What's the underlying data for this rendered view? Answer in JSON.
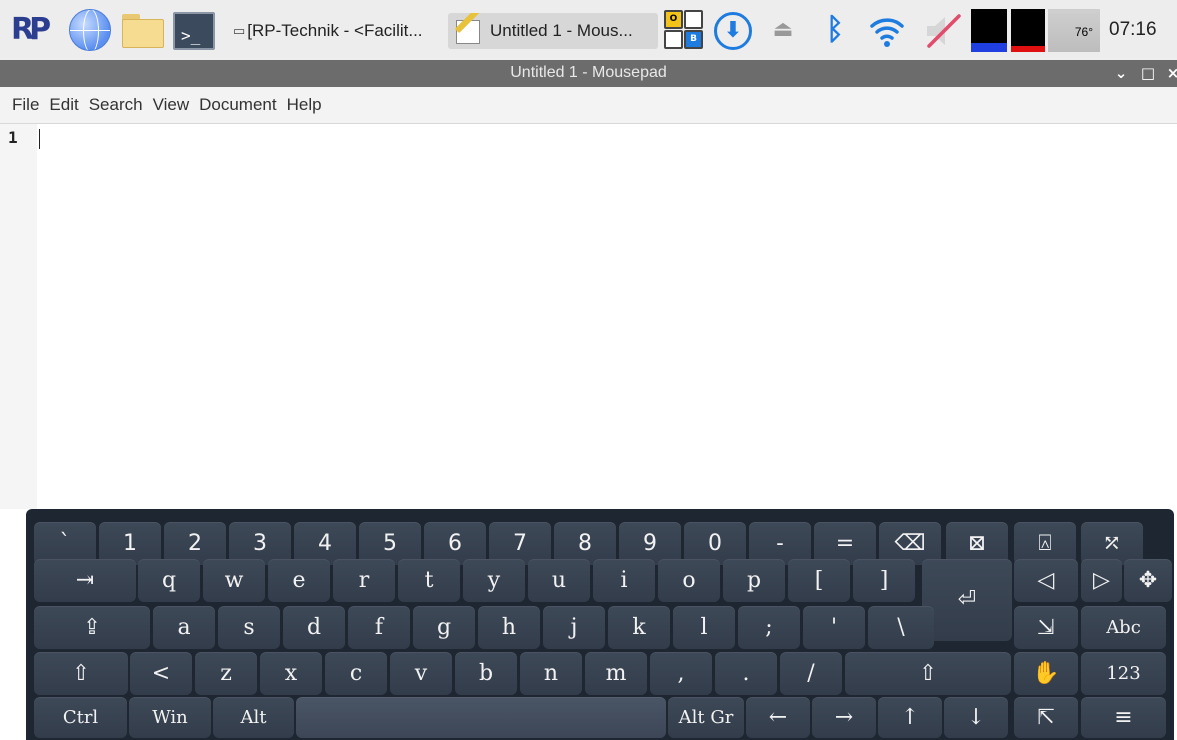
{
  "taskbar": {
    "logo_icon": "rp-logo-icon",
    "logo_text": "RP",
    "terminal_prompt": ">_",
    "task_rp_icon": "window-icon",
    "task_rp_label": "[RP-Technik - <Facilit...",
    "task_mouse_label": "Untitled 1 - Mous...",
    "ob_letters": [
      "O",
      "",
      "",
      "B"
    ],
    "update_glyph": "⬇",
    "eject_glyph": "⏏",
    "bluetooth_glyph": "ᛒ",
    "cpu_usage_fraction": 0.2,
    "memory_usage_fraction": 0.13,
    "temperature": "76°",
    "clock": "07:16"
  },
  "window": {
    "title": "Untitled 1 - Mousepad",
    "controls": {
      "minimize": "⌄",
      "maximize": "□",
      "close": "×"
    }
  },
  "menubar": {
    "items": [
      "File",
      "Edit",
      "Search",
      "View",
      "Document",
      "Help"
    ]
  },
  "editor": {
    "line_number": "1"
  },
  "keyboard": {
    "row1": [
      "`",
      "1",
      "2",
      "3",
      "4",
      "5",
      "6",
      "7",
      "8",
      "9",
      "0",
      "-",
      "=",
      "⌫",
      "⊠",
      "⍓",
      "⤱"
    ],
    "row2": [
      "⇥",
      "q",
      "w",
      "e",
      "r",
      "t",
      "y",
      "u",
      "i",
      "o",
      "p",
      "[",
      "]",
      "⏎",
      "◁",
      "▷",
      "✥"
    ],
    "row3": [
      "⇪",
      "a",
      "s",
      "d",
      "f",
      "g",
      "h",
      "j",
      "k",
      "l",
      ";",
      "'",
      "\\",
      "⇲",
      "Abc"
    ],
    "row4": [
      "⇧",
      "<",
      "z",
      "x",
      "c",
      "v",
      "b",
      "n",
      "m",
      ",",
      ".",
      "/",
      "⇧",
      "✋",
      "123"
    ],
    "row5": [
      "Ctrl",
      "Win",
      "Alt",
      "",
      "Alt Gr",
      "←",
      "→",
      "↑",
      "↓",
      "⇱",
      "≡"
    ]
  },
  "colors": {
    "taskbar_bg": "#ededed",
    "titlebar_bg": "#6c6c6c",
    "keyboard_bg": "#1e2631",
    "key_bg": "#3a4554",
    "accent_blue": "#1e7be0"
  }
}
